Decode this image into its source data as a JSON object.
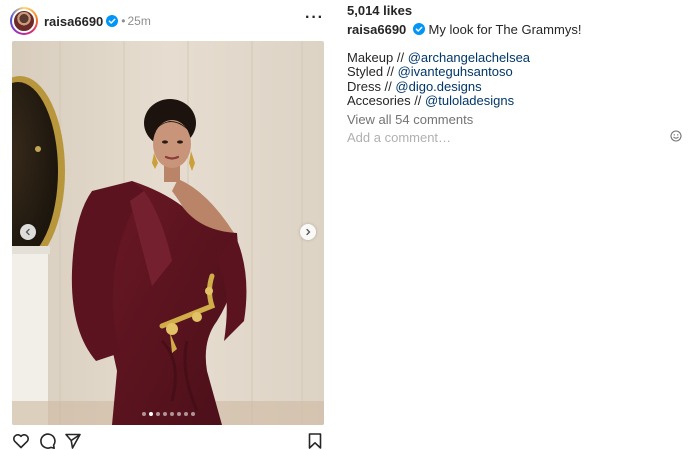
{
  "post": {
    "username": "raisa6690",
    "separator": "•",
    "time": "25m",
    "more_label": "···"
  },
  "carousel": {
    "total_slides": 8,
    "active_index": 1
  },
  "likes": "5,014 likes",
  "caption": {
    "username": "raisa6690",
    "text": "My look for The Grammys!"
  },
  "credits": [
    {
      "label": "Makeup // ",
      "handle": "@archangelachelsea"
    },
    {
      "label": "Styled // ",
      "handle": "@ivanteguhsantoso"
    },
    {
      "label": "Dress // ",
      "handle": "@digo.designs"
    },
    {
      "label": "Accesories // ",
      "handle": "@tuloladesigns"
    }
  ],
  "comments": {
    "view_all": "View all 54 comments",
    "placeholder": "Add a comment…"
  },
  "icons": {
    "verified": "verified-badge-icon",
    "like": "heart-icon",
    "comment": "comment-bubble-icon",
    "share": "paper-plane-icon",
    "save": "bookmark-icon",
    "emoji": "smiley-icon",
    "prev": "chevron-left-icon",
    "next": "chevron-right-icon",
    "more": "more-options-icon"
  },
  "colors": {
    "verified_blue": "#0095f6",
    "link": "#00376b",
    "muted": "#737373",
    "dress": "#5e1420"
  }
}
